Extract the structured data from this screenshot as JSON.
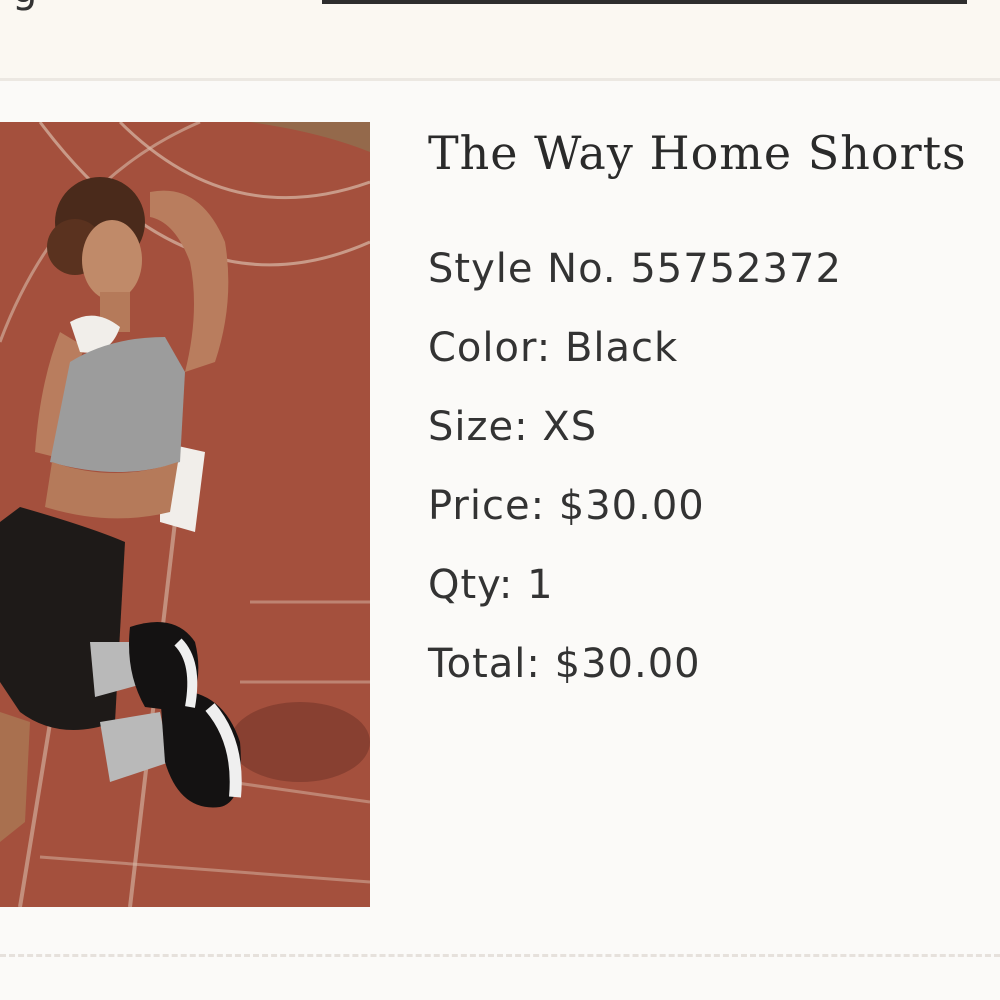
{
  "header": {
    "partial_glyph": "g"
  },
  "product": {
    "title": "The Way Home Shorts",
    "image_icon": "product-photo",
    "details": {
      "style": {
        "label": "Style No.",
        "value": "55752372"
      },
      "color": {
        "label": "Color:",
        "value": "Black"
      },
      "size": {
        "label": "Size:",
        "value": "XS"
      },
      "price": {
        "label": "Price:",
        "value": "$30.00"
      },
      "qty": {
        "label": "Qty:",
        "value": "1"
      },
      "total": {
        "label": "Total:",
        "value": "$30.00"
      }
    }
  },
  "colors": {
    "background": "#fbfaf8",
    "top_band": "#fbf8f2",
    "text": "#333333",
    "track": "#a4503d"
  }
}
